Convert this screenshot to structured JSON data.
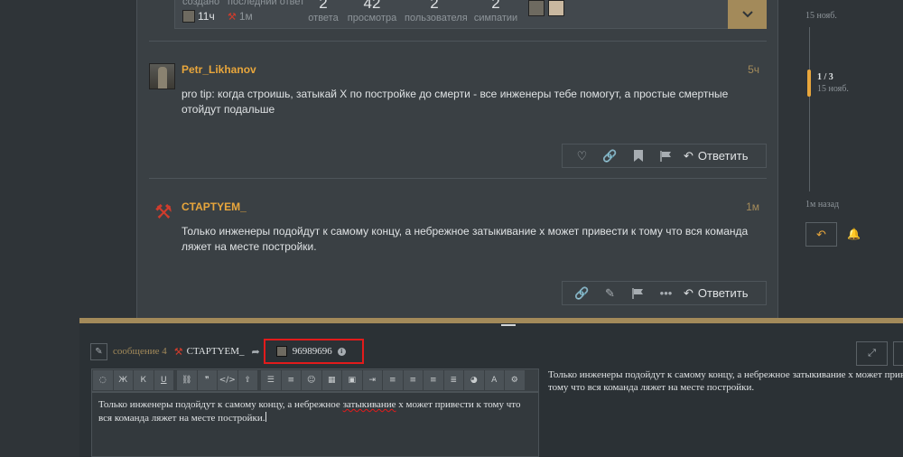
{
  "topic_map": {
    "created_label": "создано",
    "created_value": "11ч",
    "last_reply_label": "последний ответ",
    "last_reply_value": "1м",
    "stats": [
      {
        "value": "2",
        "label": "ответа"
      },
      {
        "value": "42",
        "label": "просмотра"
      },
      {
        "value": "2",
        "label": "пользователя"
      },
      {
        "value": "2",
        "label": "симпатии"
      }
    ]
  },
  "posts": [
    {
      "username": "Petr_Likhanov",
      "date": "5ч",
      "text": "pro tip: когда строишь, затыкай Х по постройке до смерти - все инженеры тебе помогут, а простые смертные отойдут подальше",
      "reply_label": "Ответить"
    },
    {
      "username": "CTAPTYEM_",
      "date": "1м",
      "text": "Только инженеры подойдут к самому концу, а небрежное затыкивание х может привести к тому что вся команда ляжет на месте постройки.",
      "reply_label": "Ответить"
    }
  ],
  "timeline": {
    "top_date": "15 нояб.",
    "position": "1 / 3",
    "position_date": "15 нояб.",
    "bottom_label": "1м назад"
  },
  "composer": {
    "reply_to_link": "сообщение 4",
    "reply_to_user": "CTAPTYEM_",
    "target_user": "96989696",
    "editor_pre": "Только инженеры подойдут к самому концу, а небрежное ",
    "editor_mark": "затыкивание",
    "editor_post": " х может привести к тому что вся команда ляжет на месте постройки.",
    "preview_line1": "Только инженеры подойдут к самому концу, а небрежное затыкивание х может привести к",
    "preview_line2": "тому что вся команда ляжет на месте постройки."
  },
  "colors": {
    "accent": "#a38a5a",
    "username": "#e8a63c",
    "highlight_box": "#e21b1b"
  }
}
